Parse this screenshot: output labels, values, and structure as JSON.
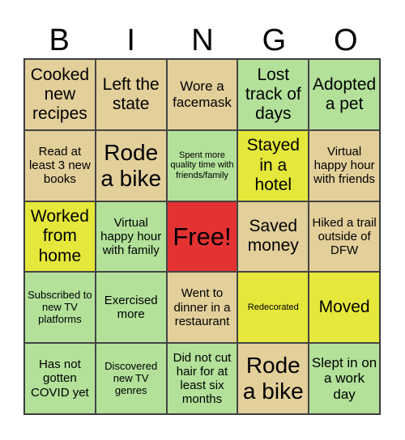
{
  "header": [
    "B",
    "I",
    "N",
    "G",
    "O"
  ],
  "colors": {
    "tan": "#e2cf9a",
    "green": "#b3e19a",
    "yellow": "#e5e83a",
    "red": "#e43232"
  },
  "cells": [
    {
      "text": "Cooked new recipes",
      "color": "tan",
      "size": "s-l"
    },
    {
      "text": "Left the state",
      "color": "tan",
      "size": "s-l"
    },
    {
      "text": "Wore a facemask",
      "color": "tan",
      "size": "s-m"
    },
    {
      "text": "Lost track of days",
      "color": "green",
      "size": "s-l"
    },
    {
      "text": "Adopted a pet",
      "color": "green",
      "size": "s-l"
    },
    {
      "text": "Read at least 3 new books",
      "color": "tan",
      "size": "s-s"
    },
    {
      "text": "Rode a bike",
      "color": "tan",
      "size": "s-xl"
    },
    {
      "text": "Spent more quality time with friends/family",
      "color": "green",
      "size": "s-xxs"
    },
    {
      "text": "Stayed in a hotel",
      "color": "yellow",
      "size": "s-l"
    },
    {
      "text": "Virtual happy hour with friends",
      "color": "tan",
      "size": "s-s"
    },
    {
      "text": "Worked from home",
      "color": "yellow",
      "size": "s-l"
    },
    {
      "text": "Virtual happy hour with family",
      "color": "green",
      "size": "s-s"
    },
    {
      "text": "Free!",
      "color": "red",
      "size": "s-free"
    },
    {
      "text": "Saved money",
      "color": "tan",
      "size": "s-l"
    },
    {
      "text": "Hiked a trail outside of DFW",
      "color": "tan",
      "size": "s-s"
    },
    {
      "text": "Subscribed to new TV platforms",
      "color": "green",
      "size": "s-xs"
    },
    {
      "text": "Exercised more",
      "color": "green",
      "size": "s-s"
    },
    {
      "text": "Went to dinner in a restaurant",
      "color": "tan",
      "size": "s-s"
    },
    {
      "text": "Redecorated",
      "color": "yellow",
      "size": "s-xxs"
    },
    {
      "text": "Moved",
      "color": "yellow",
      "size": "s-l"
    },
    {
      "text": "Has not gotten COVID yet",
      "color": "green",
      "size": "s-s"
    },
    {
      "text": "Discovered new TV genres",
      "color": "green",
      "size": "s-xs"
    },
    {
      "text": "Did not cut hair for at least six months",
      "color": "green",
      "size": "s-s"
    },
    {
      "text": "Rode a bike",
      "color": "tan",
      "size": "s-xl"
    },
    {
      "text": "Slept in on a work day",
      "color": "green",
      "size": "s-m"
    }
  ]
}
